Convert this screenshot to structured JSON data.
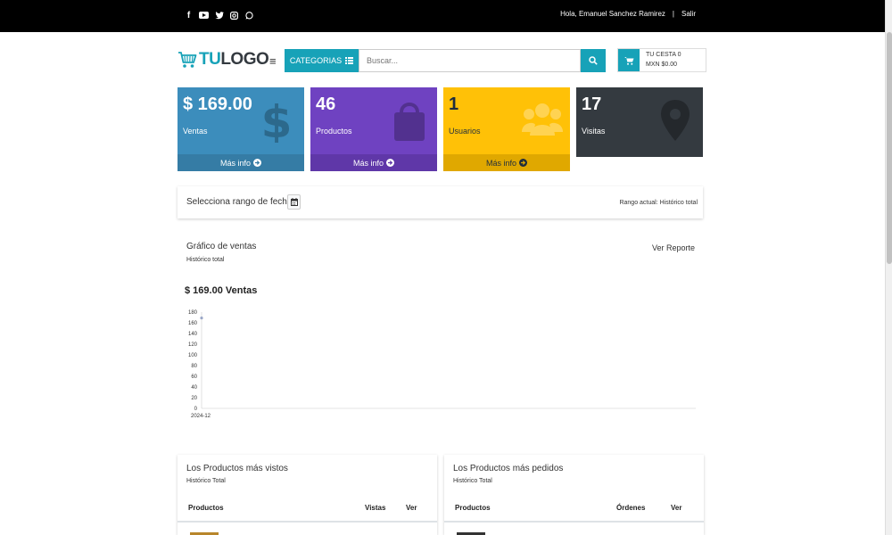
{
  "topbar": {
    "social_icons": [
      "facebook-icon",
      "youtube-icon",
      "twitter-icon",
      "instagram-icon",
      "whatsapp-icon"
    ],
    "greeting": "Hola, Emanuel Sanchez Ramirez",
    "separator": "|",
    "logout": "Salir"
  },
  "header": {
    "logo_tu": "TU",
    "logo_rest": "LOGO",
    "categories_label": "CATEGORIAS",
    "search_placeholder": "Buscar...",
    "cart_line1": "TU CESTA 0",
    "cart_line2": "MXN $0.00"
  },
  "stats": [
    {
      "value": "$ 169.00",
      "label": "Ventas",
      "more": "Más info",
      "color": "#3c8dbc",
      "icon": "dollar-icon"
    },
    {
      "value": "46",
      "label": "Productos",
      "more": "Más info",
      "color": "#6f42c1",
      "icon": "shopping-bag-icon"
    },
    {
      "value": "1",
      "label": "Usuarios",
      "more": "Más info",
      "color": "#ffc107",
      "icon": "users-icon"
    },
    {
      "value": "17",
      "label": "Visitas",
      "color": "#343a40",
      "icon": "map-marker-icon"
    }
  ],
  "date_range": {
    "title": "Selecciona rango de fecha",
    "current": "Rango actual: Histórico total"
  },
  "sales_chart": {
    "title": "Gráfico de ventas",
    "subtitle": "Histórico total",
    "report_link": "Ver Reporte",
    "total": "$ 169.00 Ventas"
  },
  "chart_data": {
    "type": "line",
    "x": [
      "2024-12"
    ],
    "series": [
      {
        "values": [
          169
        ]
      }
    ],
    "ylim": [
      0,
      180
    ],
    "yticks": [
      0,
      20,
      40,
      60,
      80,
      100,
      120,
      140,
      160,
      180
    ],
    "grid": false
  },
  "most_viewed": {
    "title": "Los Productos más vistos",
    "subtitle": "Histórico Total",
    "col1": "Productos",
    "col2": "Vistas",
    "col3": "Ver"
  },
  "most_ordered": {
    "title": "Los Productos más pedidos",
    "subtitle": "Histórico Total",
    "col1": "Productos",
    "col2": "Órdenes",
    "col3": "Ver"
  }
}
